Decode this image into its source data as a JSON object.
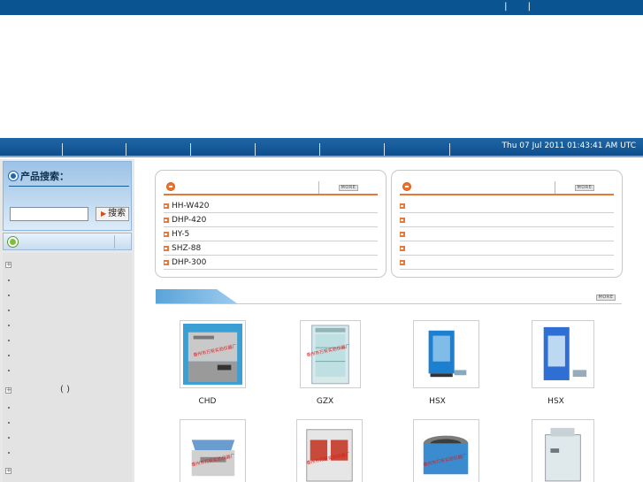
{
  "header": {
    "top_links": "|  |"
  },
  "nav": {
    "datetime": "Thu 07 Jul 2011 01:43:41 AM UTC"
  },
  "sidebar": {
    "search_title": "产品搜索：",
    "search_placeholder": "",
    "search_button": "搜索",
    "category_extra": "( )"
  },
  "panels": {
    "left": {
      "more_label": "MORE",
      "items": [
        "HH-W420",
        "DHP-420",
        "HY-5",
        "SHZ-88",
        "DHP-300"
      ]
    },
    "right": {
      "more_label": "MORE",
      "items": [
        "",
        "",
        "",
        "",
        ""
      ]
    }
  },
  "showcase": {
    "more_label": "MORE",
    "products": [
      {
        "label": "CHD",
        "color": "#3a9fd2"
      },
      {
        "label": "GZX",
        "color": "#e9f3f3"
      },
      {
        "label": "HSX",
        "color": "#1c7fd0"
      },
      {
        "label": "HSX",
        "color": "#2f6fd4"
      },
      {
        "label": "",
        "color": "#6a9ccf"
      },
      {
        "label": "",
        "color": "#c84a3a"
      },
      {
        "label": "",
        "color": "#7c7c7c"
      },
      {
        "label": "",
        "color": "#dfe8ea"
      }
    ],
    "watermark": "泰州市万安实验仪器厂"
  },
  "colors": {
    "brand_blue": "#0a5591",
    "accent_orange": "#e8783a"
  }
}
